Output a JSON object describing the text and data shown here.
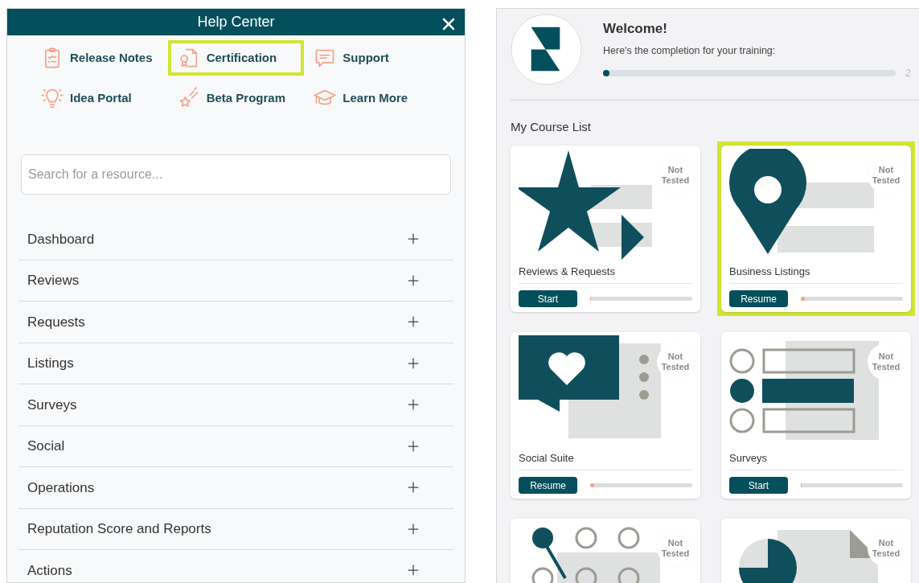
{
  "help_center": {
    "title": "Help Center",
    "links": [
      {
        "kind": "release-notes",
        "label": "Release Notes",
        "highlighted": false
      },
      {
        "kind": "certification",
        "label": "Certification",
        "highlighted": true
      },
      {
        "kind": "support",
        "label": "Support",
        "highlighted": false
      },
      {
        "kind": "idea",
        "label": "Idea Portal",
        "highlighted": false
      },
      {
        "kind": "beta",
        "label": "Beta Program",
        "highlighted": false
      },
      {
        "kind": "learn",
        "label": "Learn More",
        "highlighted": false
      }
    ],
    "search": {
      "placeholder": "Search for a resource..."
    },
    "sections": [
      {
        "label": "Dashboard",
        "expanded": false
      },
      {
        "label": "Reviews",
        "expanded": false
      },
      {
        "label": "Requests",
        "expanded": false
      },
      {
        "label": "Listings",
        "expanded": false
      },
      {
        "label": "Surveys",
        "expanded": false
      },
      {
        "label": "Social",
        "expanded": false
      },
      {
        "label": "Operations",
        "expanded": false
      },
      {
        "label": "Reputation Score and Reports",
        "expanded": false
      },
      {
        "label": "Actions",
        "expanded": false
      }
    ]
  },
  "training": {
    "welcome": "Welcome!",
    "subtitle": "Here's the completion for your training:",
    "level": 0.02,
    "percent": "2",
    "course_list_title": "My Course List",
    "courses": [
      {
        "kind": "star",
        "title": "Reviews & Requests",
        "badge": "Not Tested",
        "button": "Start",
        "level": 0,
        "highlighted": false
      },
      {
        "kind": "pin",
        "title": "Business Listings",
        "badge": "Not Tested",
        "button": "Resume",
        "level": 0.04,
        "highlighted": true
      },
      {
        "kind": "chat",
        "title": "Social Suite",
        "badge": "Not Tested",
        "button": "Resume",
        "level": 0.04,
        "highlighted": false
      },
      {
        "kind": "survey",
        "title": "Surveys",
        "badge": "Not Tested",
        "button": "Start",
        "level": 0,
        "highlighted": false
      },
      {
        "kind": "network",
        "badge": "Not Tested",
        "highlighted": false
      },
      {
        "kind": "pie",
        "badge": "Not Tested",
        "highlighted": false
      }
    ]
  }
}
